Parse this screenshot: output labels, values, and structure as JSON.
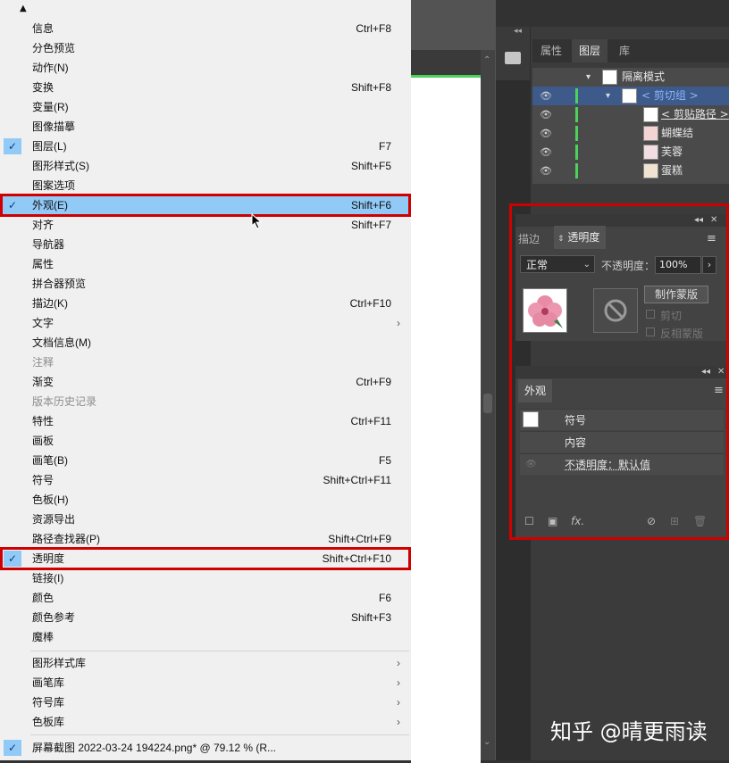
{
  "menu": {
    "items": [
      {
        "label": "信息",
        "shortcut": "Ctrl+F8"
      },
      {
        "label": "分色预览",
        "shortcut": ""
      },
      {
        "label": "动作(N)",
        "shortcut": ""
      },
      {
        "label": "变换",
        "shortcut": "Shift+F8"
      },
      {
        "label": "变量(R)",
        "shortcut": ""
      },
      {
        "label": "图像描摹",
        "shortcut": ""
      },
      {
        "label": "图层(L)",
        "shortcut": "F7",
        "checked": true
      },
      {
        "label": "图形样式(S)",
        "shortcut": "Shift+F5"
      },
      {
        "label": "图案选项",
        "shortcut": ""
      },
      {
        "label": "外观(E)",
        "shortcut": "Shift+F6",
        "checked": true,
        "selected": true
      },
      {
        "label": "对齐",
        "shortcut": "Shift+F7"
      },
      {
        "label": "导航器",
        "shortcut": ""
      },
      {
        "label": "属性",
        "shortcut": ""
      },
      {
        "label": "拼合器预览",
        "shortcut": ""
      },
      {
        "label": "描边(K)",
        "shortcut": "Ctrl+F10"
      },
      {
        "label": "文字",
        "shortcut": "",
        "submenu": true
      },
      {
        "label": "文档信息(M)",
        "shortcut": ""
      },
      {
        "label": "注释",
        "shortcut": "",
        "disabled": true
      },
      {
        "label": "渐变",
        "shortcut": "Ctrl+F9"
      },
      {
        "label": "版本历史记录",
        "shortcut": "",
        "disabled": true
      },
      {
        "label": "特性",
        "shortcut": "Ctrl+F11"
      },
      {
        "label": "画板",
        "shortcut": ""
      },
      {
        "label": "画笔(B)",
        "shortcut": "F5"
      },
      {
        "label": "符号",
        "shortcut": "Shift+Ctrl+F11"
      },
      {
        "label": "色板(H)",
        "shortcut": ""
      },
      {
        "label": "资源导出",
        "shortcut": ""
      },
      {
        "label": "路径查找器(P)",
        "shortcut": "Shift+Ctrl+F9"
      },
      {
        "label": "透明度",
        "shortcut": "Shift+Ctrl+F10",
        "checked": true
      },
      {
        "label": "链接(I)",
        "shortcut": ""
      },
      {
        "label": "颜色",
        "shortcut": "F6"
      },
      {
        "label": "颜色参考",
        "shortcut": "Shift+F3"
      },
      {
        "label": "魔棒",
        "shortcut": ""
      }
    ],
    "libraries": [
      {
        "label": "图形样式库"
      },
      {
        "label": "画笔库"
      },
      {
        "label": "符号库"
      },
      {
        "label": "色板库"
      }
    ],
    "document": {
      "label": "屏幕截图 2022-03-24 194224.png* @ 79.12 % (R...",
      "checked": true
    }
  },
  "layers_panel": {
    "tabs": [
      "属性",
      "图层",
      "库"
    ],
    "active_tab": "图层",
    "rows": [
      {
        "name": "隔离模式",
        "eye": false,
        "bar": false,
        "expand": "down",
        "indent": 78
      },
      {
        "name": "< 剪切组 >",
        "eye": true,
        "bar": true,
        "expand": "down",
        "indent": 100,
        "selected": true
      },
      {
        "name": "< 剪贴路径 >",
        "eye": true,
        "bar": true,
        "indent": 124,
        "underline": true
      },
      {
        "name": "蝴蝶结",
        "eye": true,
        "bar": true,
        "indent": 124
      },
      {
        "name": "芙蓉",
        "eye": true,
        "bar": true,
        "indent": 124
      },
      {
        "name": "蛋糕",
        "eye": true,
        "bar": true,
        "indent": 124
      }
    ]
  },
  "transparency_panel": {
    "tabs": [
      "描边",
      "透明度"
    ],
    "blend_mode": "正常",
    "opacity_label": "不透明度：",
    "opacity_value": "100%",
    "make_mask_label": "制作蒙版",
    "clip_label": "剪切",
    "invert_label": "反相蒙版"
  },
  "appearance_panel": {
    "tab": "外观",
    "rows": [
      "符号",
      "内容",
      "不透明度：默认值"
    ]
  },
  "watermark": "知乎 @晴更雨读",
  "colors": {
    "highlight": "#91c9f7",
    "red_box": "#d00000",
    "layer_bar": "#4bd25a",
    "selected_layer": "#3d5a8a"
  }
}
